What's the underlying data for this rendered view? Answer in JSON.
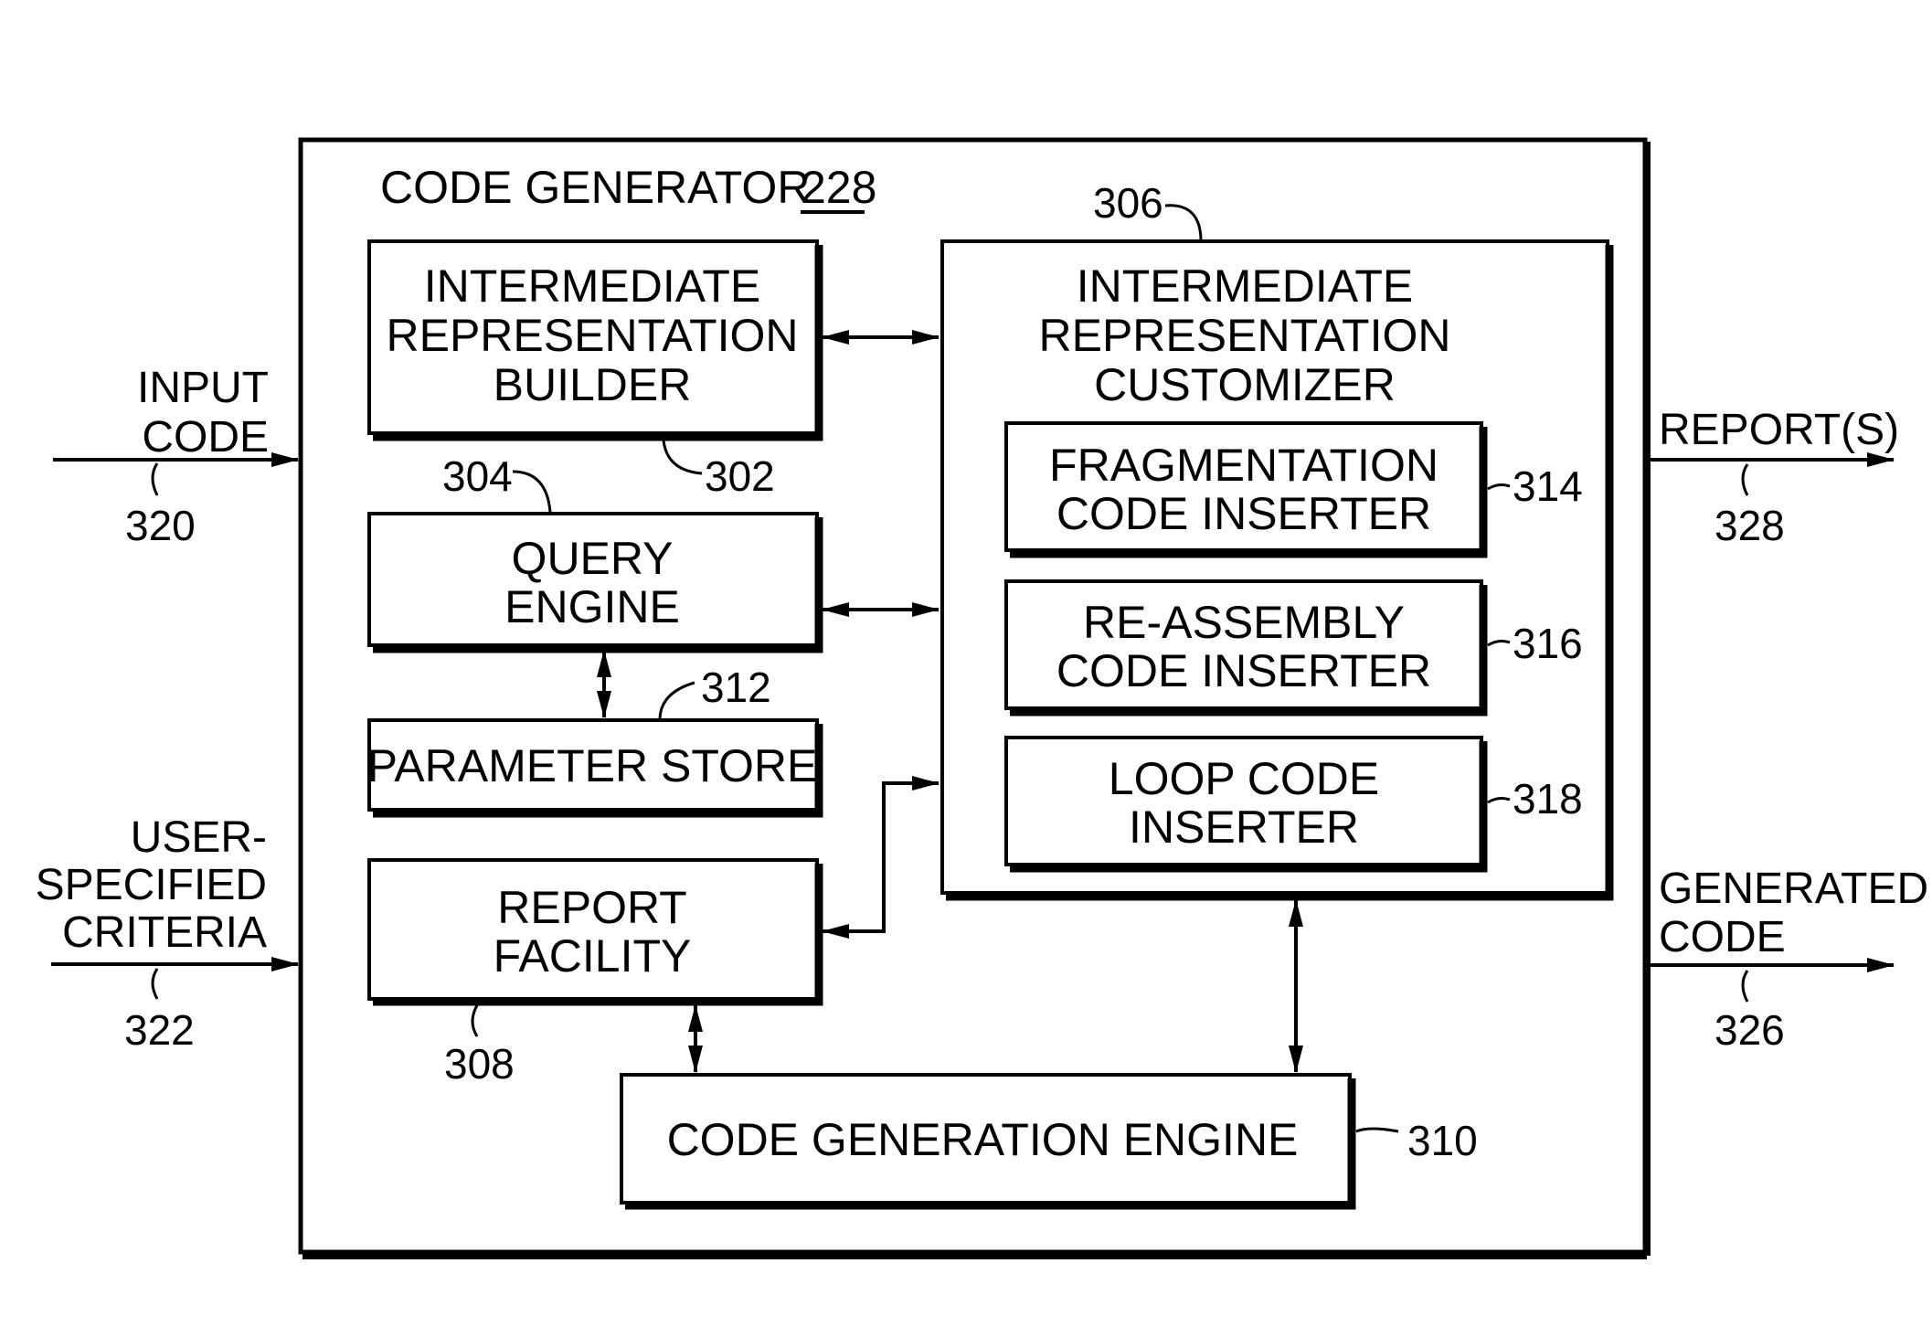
{
  "diagram": {
    "title": "CODE GENERATOR",
    "title_ref": "228",
    "inputs": [
      {
        "id": "input-code",
        "lines": [
          "INPUT",
          "CODE"
        ],
        "ref": "320"
      },
      {
        "id": "user-specified-criteria",
        "lines": [
          "USER-",
          "SPECIFIED",
          "CRITERIA"
        ],
        "ref": "322"
      }
    ],
    "outputs": [
      {
        "id": "reports",
        "lines": [
          "REPORT(S)"
        ],
        "ref": "328"
      },
      {
        "id": "generated-code",
        "lines": [
          "GENERATED",
          "CODE"
        ],
        "ref": "326"
      }
    ],
    "blocks": {
      "ir_builder": {
        "lines": [
          "INTERMEDIATE",
          "REPRESENTATION",
          "BUILDER"
        ],
        "ref": "302"
      },
      "query_engine": {
        "lines": [
          "QUERY",
          "ENGINE"
        ],
        "ref": "304"
      },
      "parameter_store": {
        "lines": [
          "PARAMETER STORE"
        ],
        "ref": "312"
      },
      "report_facility": {
        "lines": [
          "REPORT",
          "FACILITY"
        ],
        "ref": "308"
      },
      "ir_customizer": {
        "lines": [
          "INTERMEDIATE",
          "REPRESENTATION",
          "CUSTOMIZER"
        ],
        "ref": "306"
      },
      "fragmentation_inserter": {
        "lines": [
          "FRAGMENTATION",
          "CODE INSERTER"
        ],
        "ref": "314"
      },
      "reassembly_inserter": {
        "lines": [
          "RE-ASSEMBLY",
          "CODE INSERTER"
        ],
        "ref": "316"
      },
      "loop_inserter": {
        "lines": [
          "LOOP CODE",
          "INSERTER"
        ],
        "ref": "318"
      },
      "code_gen_engine": {
        "lines": [
          "CODE GENERATION ENGINE"
        ],
        "ref": "310"
      }
    },
    "connections": [
      {
        "from": "input-code",
        "to": "code-generator",
        "direction": "one-way"
      },
      {
        "from": "user-specified-criteria",
        "to": "code-generator",
        "direction": "one-way"
      },
      {
        "from": "code-generator",
        "to": "reports",
        "direction": "one-way"
      },
      {
        "from": "code-generator",
        "to": "generated-code",
        "direction": "one-way"
      },
      {
        "from": "ir_builder",
        "to": "ir_customizer",
        "direction": "two-way"
      },
      {
        "from": "query_engine",
        "to": "ir_customizer",
        "direction": "two-way"
      },
      {
        "from": "query_engine",
        "to": "parameter_store",
        "direction": "two-way"
      },
      {
        "from": "report_facility",
        "to": "ir_customizer",
        "direction": "two-way"
      },
      {
        "from": "report_facility",
        "to": "code_gen_engine",
        "direction": "two-way"
      },
      {
        "from": "ir_customizer",
        "to": "code_gen_engine",
        "direction": "two-way"
      }
    ]
  }
}
